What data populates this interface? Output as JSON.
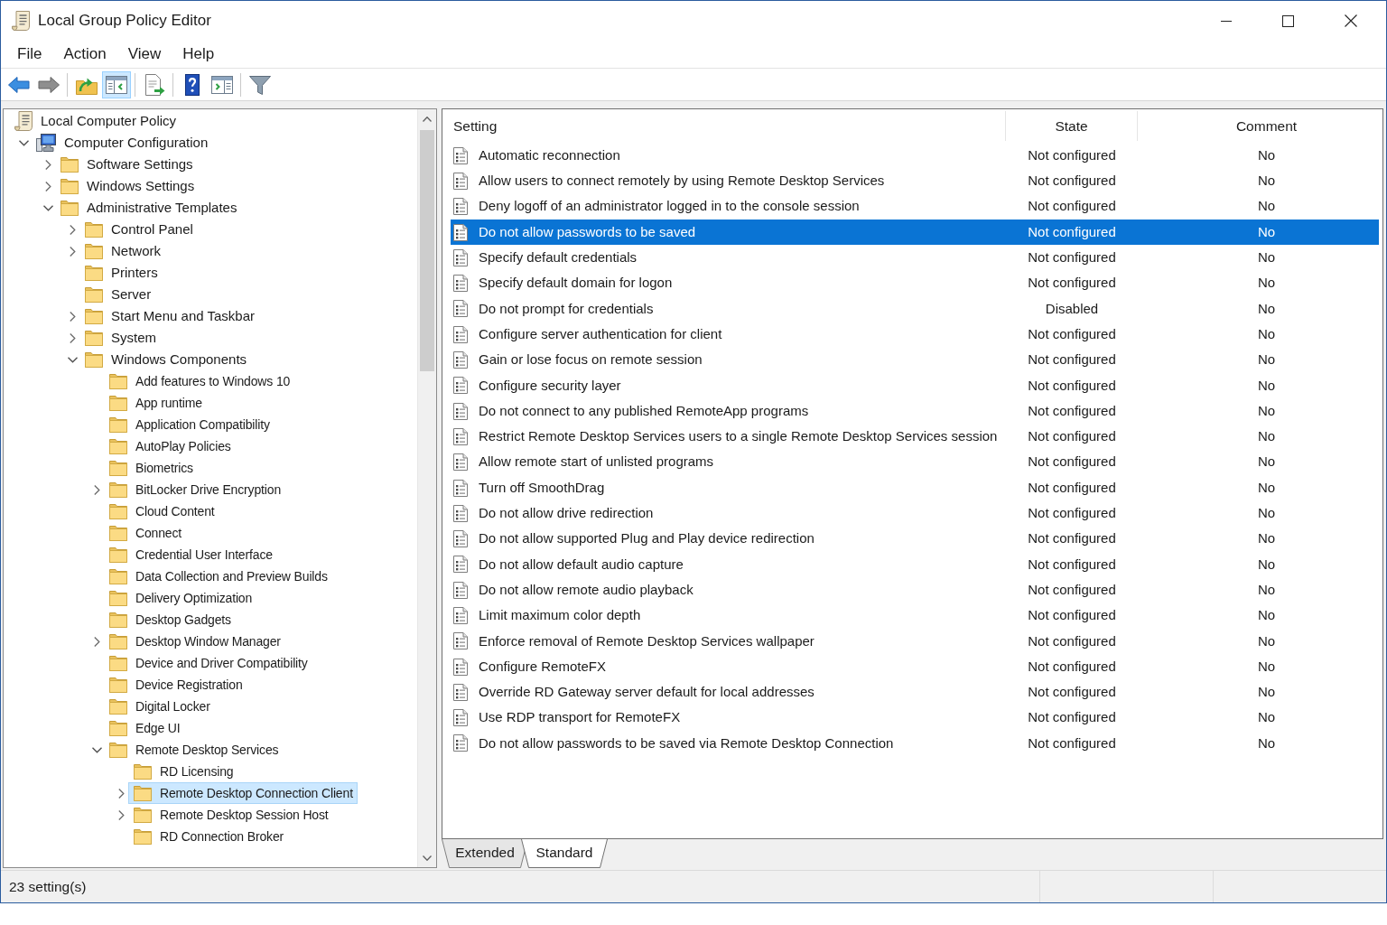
{
  "window": {
    "title": "Local Group Policy Editor"
  },
  "menu": [
    "File",
    "Action",
    "View",
    "Help"
  ],
  "toolbar": [
    {
      "buttons": [
        {
          "kind": "back",
          "pressed": false,
          "disabled": false
        },
        {
          "kind": "forward",
          "pressed": false,
          "disabled": true
        }
      ]
    },
    {
      "buttons": [
        {
          "kind": "up",
          "pressed": false,
          "disabled": false
        },
        {
          "kind": "console-tree",
          "pressed": true,
          "disabled": false
        }
      ]
    },
    {
      "buttons": [
        {
          "kind": "export",
          "pressed": false,
          "disabled": false
        }
      ]
    },
    {
      "buttons": [
        {
          "kind": "help",
          "pressed": false,
          "disabled": false
        },
        {
          "kind": "action-pane",
          "pressed": false,
          "disabled": false
        }
      ]
    },
    {
      "buttons": [
        {
          "kind": "filter",
          "pressed": false,
          "disabled": false
        }
      ]
    }
  ],
  "tree": [
    {
      "label": "Local Computer Policy",
      "kind": "policy",
      "selected": false,
      "children": [
        {
          "label": "Computer Configuration",
          "kind": "computer",
          "expanded": true,
          "selected": false,
          "children": [
            {
              "label": "Software Settings",
              "kind": "folder",
              "expanded": false,
              "selected": false
            },
            {
              "label": "Windows Settings",
              "kind": "folder",
              "expanded": false,
              "selected": false
            },
            {
              "label": "Administrative Templates",
              "kind": "folder",
              "expanded": true,
              "selected": false,
              "children": [
                {
                  "label": "Control Panel",
                  "kind": "folder",
                  "expanded": false,
                  "selected": false
                },
                {
                  "label": "Network",
                  "kind": "folder",
                  "expanded": false,
                  "selected": false
                },
                {
                  "label": "Printers",
                  "kind": "folder",
                  "selected": false
                },
                {
                  "label": "Server",
                  "kind": "folder",
                  "selected": false
                },
                {
                  "label": "Start Menu and Taskbar",
                  "kind": "folder",
                  "expanded": false,
                  "selected": false
                },
                {
                  "label": "System",
                  "kind": "folder",
                  "expanded": false,
                  "selected": false
                },
                {
                  "label": "Windows Components",
                  "kind": "folder",
                  "expanded": true,
                  "selected": false,
                  "children": [
                    {
                      "label": "Add features to Windows 10",
                      "kind": "folder",
                      "selected": false
                    },
                    {
                      "label": "App runtime",
                      "kind": "folder",
                      "selected": false
                    },
                    {
                      "label": "Application Compatibility",
                      "kind": "folder",
                      "selected": false
                    },
                    {
                      "label": "AutoPlay Policies",
                      "kind": "folder",
                      "selected": false
                    },
                    {
                      "label": "Biometrics",
                      "kind": "folder",
                      "selected": false
                    },
                    {
                      "label": "BitLocker Drive Encryption",
                      "kind": "folder",
                      "expanded": false,
                      "selected": false
                    },
                    {
                      "label": "Cloud Content",
                      "kind": "folder",
                      "selected": false
                    },
                    {
                      "label": "Connect",
                      "kind": "folder",
                      "selected": false
                    },
                    {
                      "label": "Credential User Interface",
                      "kind": "folder",
                      "selected": false
                    },
                    {
                      "label": "Data Collection and Preview Builds",
                      "kind": "folder",
                      "selected": false
                    },
                    {
                      "label": "Delivery Optimization",
                      "kind": "folder",
                      "selected": false
                    },
                    {
                      "label": "Desktop Gadgets",
                      "kind": "folder",
                      "selected": false
                    },
                    {
                      "label": "Desktop Window Manager",
                      "kind": "folder",
                      "expanded": false,
                      "selected": false
                    },
                    {
                      "label": "Device and Driver Compatibility",
                      "kind": "folder",
                      "selected": false
                    },
                    {
                      "label": "Device Registration",
                      "kind": "folder",
                      "selected": false
                    },
                    {
                      "label": "Digital Locker",
                      "kind": "folder",
                      "selected": false
                    },
                    {
                      "label": "Edge UI",
                      "kind": "folder",
                      "selected": false
                    },
                    {
                      "label": "Remote Desktop Services",
                      "kind": "folder",
                      "expanded": true,
                      "selected": false,
                      "children": [
                        {
                          "label": "RD Licensing",
                          "kind": "folder",
                          "selected": false
                        },
                        {
                          "label": "Remote Desktop Connection Client",
                          "kind": "folder",
                          "expanded": false,
                          "selected": true
                        },
                        {
                          "label": "Remote Desktop Session Host",
                          "kind": "folder",
                          "expanded": false,
                          "selected": false
                        },
                        {
                          "label": "RD Connection Broker",
                          "kind": "folder",
                          "selected": false
                        }
                      ]
                    }
                  ]
                }
              ]
            }
          ]
        }
      ]
    }
  ],
  "table": {
    "columns": [
      "Setting",
      "State",
      "Comment"
    ],
    "rows": [
      {
        "setting": "Automatic reconnection",
        "state": "Not configured",
        "comment": "No",
        "selected": false
      },
      {
        "setting": "Allow users to connect remotely by using Remote Desktop Services",
        "state": "Not configured",
        "comment": "No",
        "selected": false
      },
      {
        "setting": "Deny logoff of an administrator logged in to the console session",
        "state": "Not configured",
        "comment": "No",
        "selected": false
      },
      {
        "setting": "Do not allow passwords to be saved",
        "state": "Not configured",
        "comment": "No",
        "selected": true
      },
      {
        "setting": "Specify default credentials",
        "state": "Not configured",
        "comment": "No",
        "selected": false
      },
      {
        "setting": "Specify default domain for logon",
        "state": "Not configured",
        "comment": "No",
        "selected": false
      },
      {
        "setting": "Do not prompt for credentials",
        "state": "Disabled",
        "comment": "No",
        "selected": false
      },
      {
        "setting": "Configure server authentication for client",
        "state": "Not configured",
        "comment": "No",
        "selected": false
      },
      {
        "setting": "Gain or lose focus on remote session",
        "state": "Not configured",
        "comment": "No",
        "selected": false
      },
      {
        "setting": "Configure security layer",
        "state": "Not configured",
        "comment": "No",
        "selected": false
      },
      {
        "setting": "Do not connect to any published RemoteApp programs",
        "state": "Not configured",
        "comment": "No",
        "selected": false
      },
      {
        "setting": "Restrict Remote Desktop Services users to a single Remote Desktop Services session",
        "state": "Not configured",
        "comment": "No",
        "selected": false
      },
      {
        "setting": "Allow remote start of unlisted programs",
        "state": "Not configured",
        "comment": "No",
        "selected": false
      },
      {
        "setting": "Turn off SmoothDrag",
        "state": "Not configured",
        "comment": "No",
        "selected": false
      },
      {
        "setting": "Do not allow drive redirection",
        "state": "Not configured",
        "comment": "No",
        "selected": false
      },
      {
        "setting": "Do not allow supported Plug and Play device redirection",
        "state": "Not configured",
        "comment": "No",
        "selected": false
      },
      {
        "setting": "Do not allow default audio capture",
        "state": "Not configured",
        "comment": "No",
        "selected": false
      },
      {
        "setting": "Do not allow remote audio playback",
        "state": "Not configured",
        "comment": "No",
        "selected": false
      },
      {
        "setting": "Limit maximum color depth",
        "state": "Not configured",
        "comment": "No",
        "selected": false
      },
      {
        "setting": "Enforce removal of Remote Desktop Services wallpaper",
        "state": "Not configured",
        "comment": "No",
        "selected": false
      },
      {
        "setting": "Configure RemoteFX",
        "state": "Not configured",
        "comment": "No",
        "selected": false
      },
      {
        "setting": "Override RD Gateway server default for local addresses",
        "state": "Not configured",
        "comment": "No",
        "selected": false
      },
      {
        "setting": "Use RDP transport for RemoteFX",
        "state": "Not configured",
        "comment": "No",
        "selected": false
      },
      {
        "setting": "Do not allow passwords to be saved via Remote Desktop Connection",
        "state": "Not configured",
        "comment": "No",
        "selected": false
      }
    ]
  },
  "tabs": [
    {
      "label": "Extended",
      "selected": false
    },
    {
      "label": "Standard",
      "selected": true
    }
  ],
  "status_bar": {
    "text": "23 setting(s)"
  }
}
